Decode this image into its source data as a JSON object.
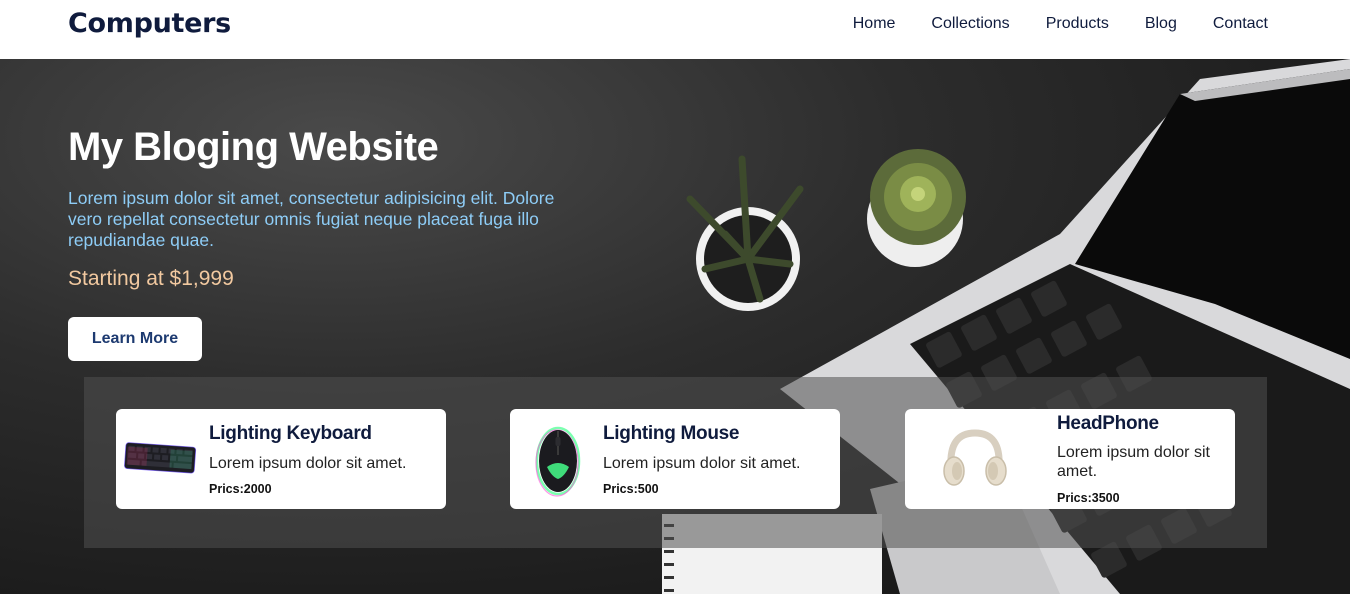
{
  "header": {
    "brand": "Computers",
    "nav": [
      "Home",
      "Collections",
      "Products",
      "Blog",
      "Contact"
    ]
  },
  "hero": {
    "title": "My Bloging Website",
    "description": "Lorem ipsum dolor sit amet, consectetur adipisicing elit. Dolore vero repellat consectetur omnis fugiat neque placeat fuga illo repudiandae quae.",
    "price_text": "Starting at $1,999",
    "button_label": "Learn More"
  },
  "products": [
    {
      "name": "Lighting Keyboard",
      "description": "Lorem ipsum dolor sit amet.",
      "price": "Prics:2000",
      "icon": "keyboard-icon"
    },
    {
      "name": "Lighting Mouse",
      "description": "Lorem ipsum dolor sit amet.",
      "price": "Prics:500",
      "icon": "mouse-icon"
    },
    {
      "name": "HeadPhone",
      "description": "Lorem ipsum dolor sit amet.",
      "price": "Prics:3500",
      "icon": "headphone-icon"
    }
  ],
  "colors": {
    "brand_navy": "#0f1b3d",
    "hero_desc": "#8ecdf7",
    "hero_price": "#f2c9a0",
    "button_text": "#1d3a70"
  }
}
